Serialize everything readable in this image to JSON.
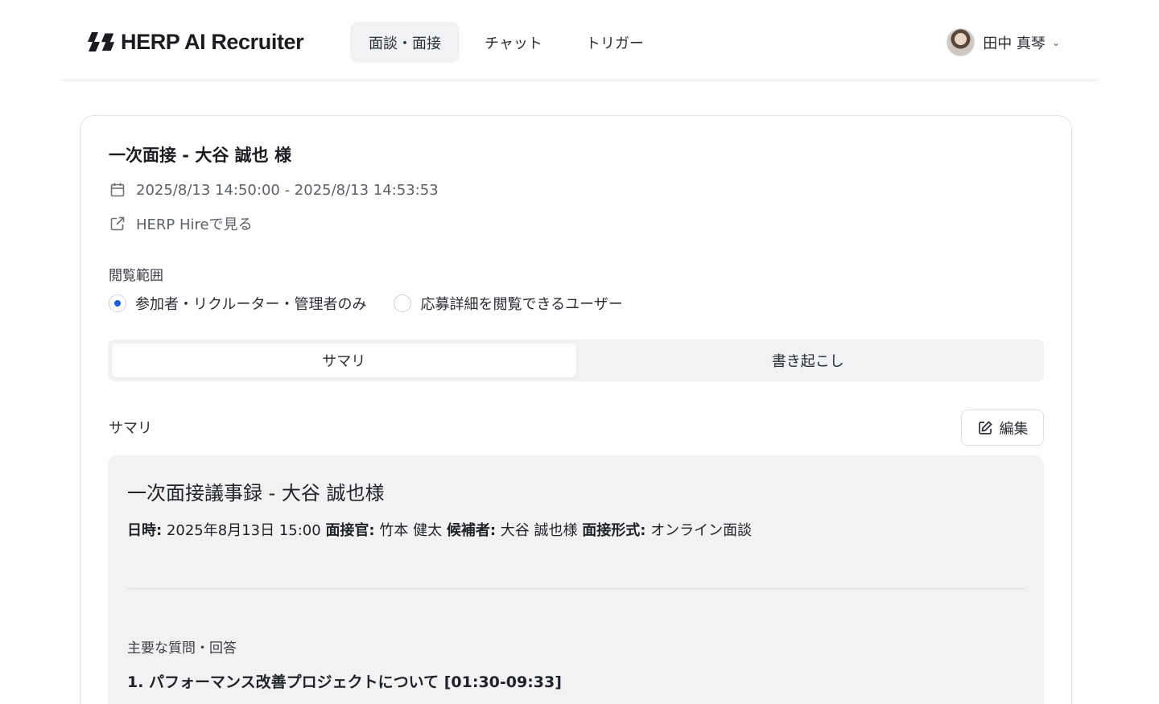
{
  "app": {
    "logo_text": "HERP AI Recruiter"
  },
  "nav": {
    "items": [
      {
        "label": "面談・面接",
        "active": true
      },
      {
        "label": "チャット",
        "active": false
      },
      {
        "label": "トリガー",
        "active": false
      }
    ]
  },
  "user": {
    "name": "田中 真琴"
  },
  "interview": {
    "title": "一次面接 - 大谷 誠也 様",
    "datetime": "2025/8/13 14:50:00 - 2025/8/13 14:53:53",
    "external_link": "HERP Hireで見る"
  },
  "visibility": {
    "label": "閲覧範囲",
    "options": [
      {
        "label": "参加者・リクルーター・管理者のみ",
        "selected": true
      },
      {
        "label": "応募詳細を閲覧できるユーザー",
        "selected": false
      }
    ]
  },
  "tabs": [
    {
      "label": "サマリ",
      "active": true
    },
    {
      "label": "書き起こし",
      "active": false
    }
  ],
  "summary": {
    "section_label": "サマリ",
    "edit_label": "編集",
    "doc_title": "一次面接議事録 - 大谷 誠也様",
    "meta": {
      "date_key": "日時:",
      "date_val": "2025年8月13日 15:00",
      "interviewer_key": "面接官:",
      "interviewer_val": "竹本 健太",
      "candidate_key": "候補者:",
      "candidate_val": "大谷 誠也様",
      "format_key": "面接形式:",
      "format_val": "オンライン面談"
    },
    "questions_heading": "主要な質問・回答",
    "question_1": "1. パフォーマンス改善プロジェクトについて [01:30-09:33]"
  },
  "colors": {
    "accent": "#1f5fe0",
    "nav_active_bg": "#f1f2f4",
    "summary_bg": "#f2f2f3"
  }
}
